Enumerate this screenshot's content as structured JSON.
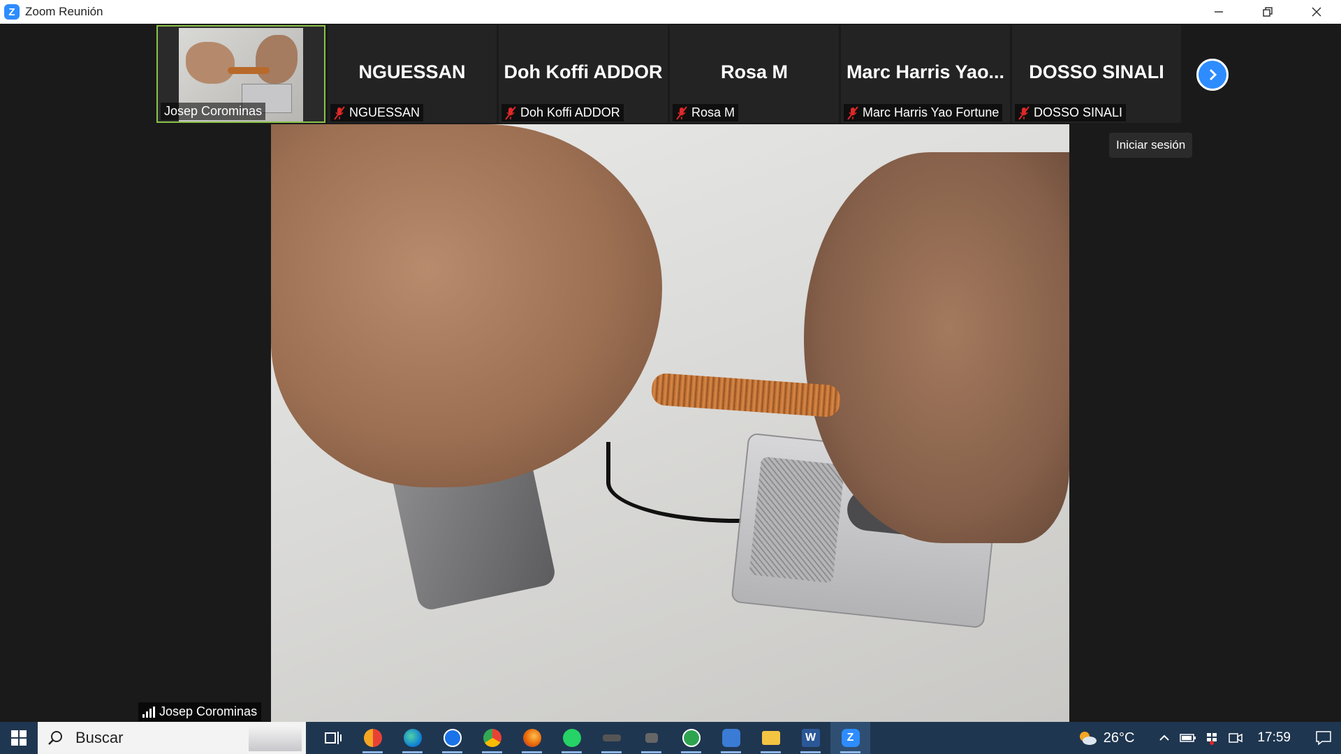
{
  "window": {
    "title": "Zoom Reunión",
    "controls": [
      "minimize",
      "restore",
      "close"
    ]
  },
  "participants": [
    {
      "display": "",
      "label": "Josep Corominas",
      "active": true,
      "muted": false
    },
    {
      "display": "NGUESSAN",
      "label": "NGUESSAN",
      "active": false,
      "muted": true
    },
    {
      "display": "Doh Koffi ADDOR",
      "label": "Doh Koffi ADDOR",
      "active": false,
      "muted": true
    },
    {
      "display": "Rosa M",
      "label": "Rosa M",
      "active": false,
      "muted": true
    },
    {
      "display": "Marc Harris Yao...",
      "label": "Marc Harris Yao Fortune",
      "active": false,
      "muted": true
    },
    {
      "display": "DOSSO SINALI",
      "label": "DOSSO SINALI",
      "active": false,
      "muted": true
    }
  ],
  "tooltip": "Iniciar sesión",
  "speaker": {
    "name": "Josep Corominas"
  },
  "taskbar": {
    "search_placeholder": "Buscar",
    "apps": [
      "task-view",
      "app-red",
      "edge",
      "teamviewer",
      "chrome",
      "firefox",
      "whatsapp",
      "app-dark-1",
      "app-dark-2",
      "app-green",
      "app-blue",
      "file-explorer",
      "word",
      "zoom"
    ],
    "active_app": "zoom",
    "temperature": "26°C",
    "time": "17:59"
  },
  "colors": {
    "zoom_blue": "#2d8cff",
    "active_border": "#8ac34a",
    "mute_red": "#e02828",
    "taskbar_bg": "#1f3650"
  }
}
